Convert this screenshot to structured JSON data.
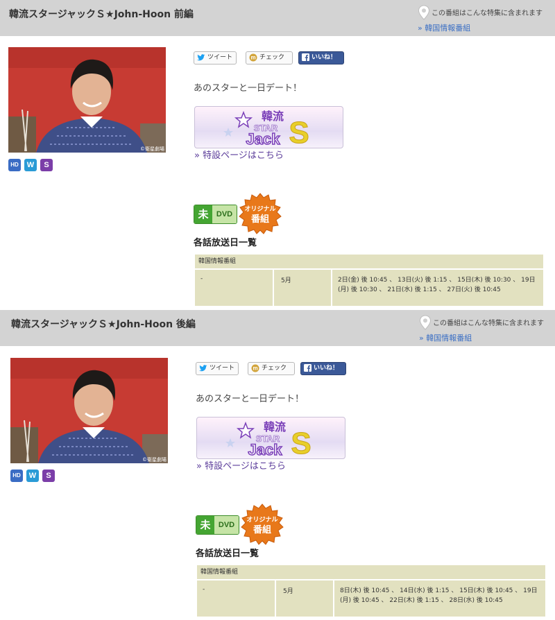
{
  "programs": [
    {
      "title": "韓流スタージャックＳ★John-Hoon 前編",
      "featured_label": "この番組はこんな特集に含まれます",
      "featured_link": "» 韓国情報番組",
      "share": {
        "tweet": "ツイート",
        "check": "チェック",
        "like": "いいね！"
      },
      "badges": [
        "HD",
        "W",
        "S"
      ],
      "tagline": "あのスターと一日デート！",
      "banner_text": {
        "top": "韓流",
        "mid": "STAR",
        "bottom": "Jack",
        "letter": "S"
      },
      "special_link": "» 特設ページはこちら",
      "dvd_badge": {
        "mi": "未",
        "dvd": "DVD"
      },
      "original_badge": {
        "line1": "オリジナル",
        "line2": "番組"
      },
      "photo_credit": "©衛星劇場",
      "schedule_heading": "各話放送日一覧",
      "schedule": {
        "category": "韓国情報番組",
        "episode": "-",
        "month": "5月",
        "dates": "2日(金) 後 10:45 、 13日(火) 後 1:15 、 15日(木) 後 10:30 、 19日(月) 後 10:30 、 21日(水) 後 1:15 、 27日(火) 後 10:45"
      }
    },
    {
      "title": "韓流スタージャックＳ★John-Hoon 後編",
      "featured_label": "この番組はこんな特集に含まれます",
      "featured_link": "» 韓国情報番組",
      "share": {
        "tweet": "ツイート",
        "check": "チェック",
        "like": "いいね！"
      },
      "badges": [
        "HD",
        "W",
        "S"
      ],
      "tagline": "あのスターと一日デート！",
      "banner_text": {
        "top": "韓流",
        "mid": "STAR",
        "bottom": "Jack",
        "letter": "S"
      },
      "special_link": "» 特設ページはこちら",
      "dvd_badge": {
        "mi": "未",
        "dvd": "DVD"
      },
      "original_badge": {
        "line1": "オリジナル",
        "line2": "番組"
      },
      "photo_credit": "©衛星劇場",
      "schedule_heading": "各話放送日一覧",
      "schedule": {
        "category": "韓国情報番組",
        "episode": "-",
        "month": "5月",
        "dates": "8日(木) 後 10:45 、 14日(水) 後 1:15 、 15日(木) 後 10:45 、 19日(月) 後 10:45 、 22日(木) 後 1:15 、 28日(水) 後 10:45"
      }
    }
  ],
  "colors": {
    "header_bg": "#d3d3d3",
    "link": "#3b6fc4",
    "special_link": "#5b3c9a",
    "table_cell": "#e2e1c0",
    "facebook": "#3b5998",
    "dvd_green": "#44a532",
    "original_orange": "#e8781a"
  }
}
